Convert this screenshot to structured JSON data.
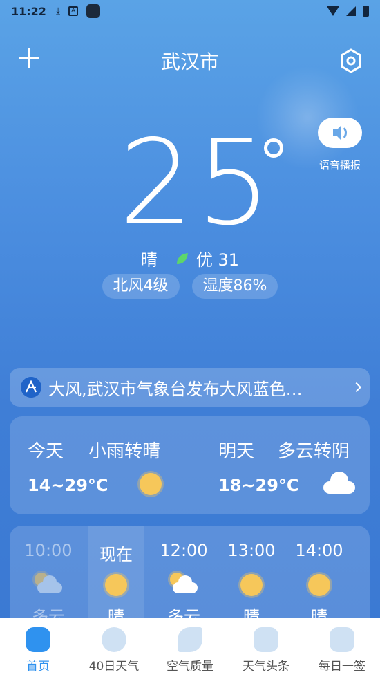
{
  "status_bar": {
    "time": "11:22"
  },
  "header": {
    "city": "武汉市"
  },
  "current": {
    "temperature": "25",
    "condition": "晴",
    "aqi_label": "优 31",
    "wind": "北风4级",
    "humidity": "湿度86%"
  },
  "voice": {
    "label": "语音播报"
  },
  "alert": {
    "text": "大风,武汉市气象台发布大风蓝色…"
  },
  "forecast": {
    "today": {
      "day": "今天",
      "condition": "小雨转晴",
      "range": "14~29°C"
    },
    "tomorrow": {
      "day": "明天",
      "condition": "多云转阴",
      "range": "18~29°C"
    }
  },
  "hourly": [
    {
      "time": "10:00",
      "condition": "多云",
      "icon": "partly-cloudy-icon"
    },
    {
      "time": "现在",
      "condition": "晴",
      "icon": "sun-icon"
    },
    {
      "time": "12:00",
      "condition": "多云",
      "icon": "partly-cloudy-icon"
    },
    {
      "time": "13:00",
      "condition": "晴",
      "icon": "sun-icon"
    },
    {
      "time": "14:00",
      "condition": "晴",
      "icon": "sun-icon"
    }
  ],
  "tabs": [
    {
      "label": "首页",
      "active": true
    },
    {
      "label": "40日天气",
      "active": false
    },
    {
      "label": "空气质量",
      "active": false
    },
    {
      "label": "天气头条",
      "active": false
    },
    {
      "label": "每日一签",
      "active": false
    }
  ],
  "colors": {
    "accent": "#2f92ef",
    "sun": "#f6c75a",
    "leaf": "#5dd66a"
  }
}
